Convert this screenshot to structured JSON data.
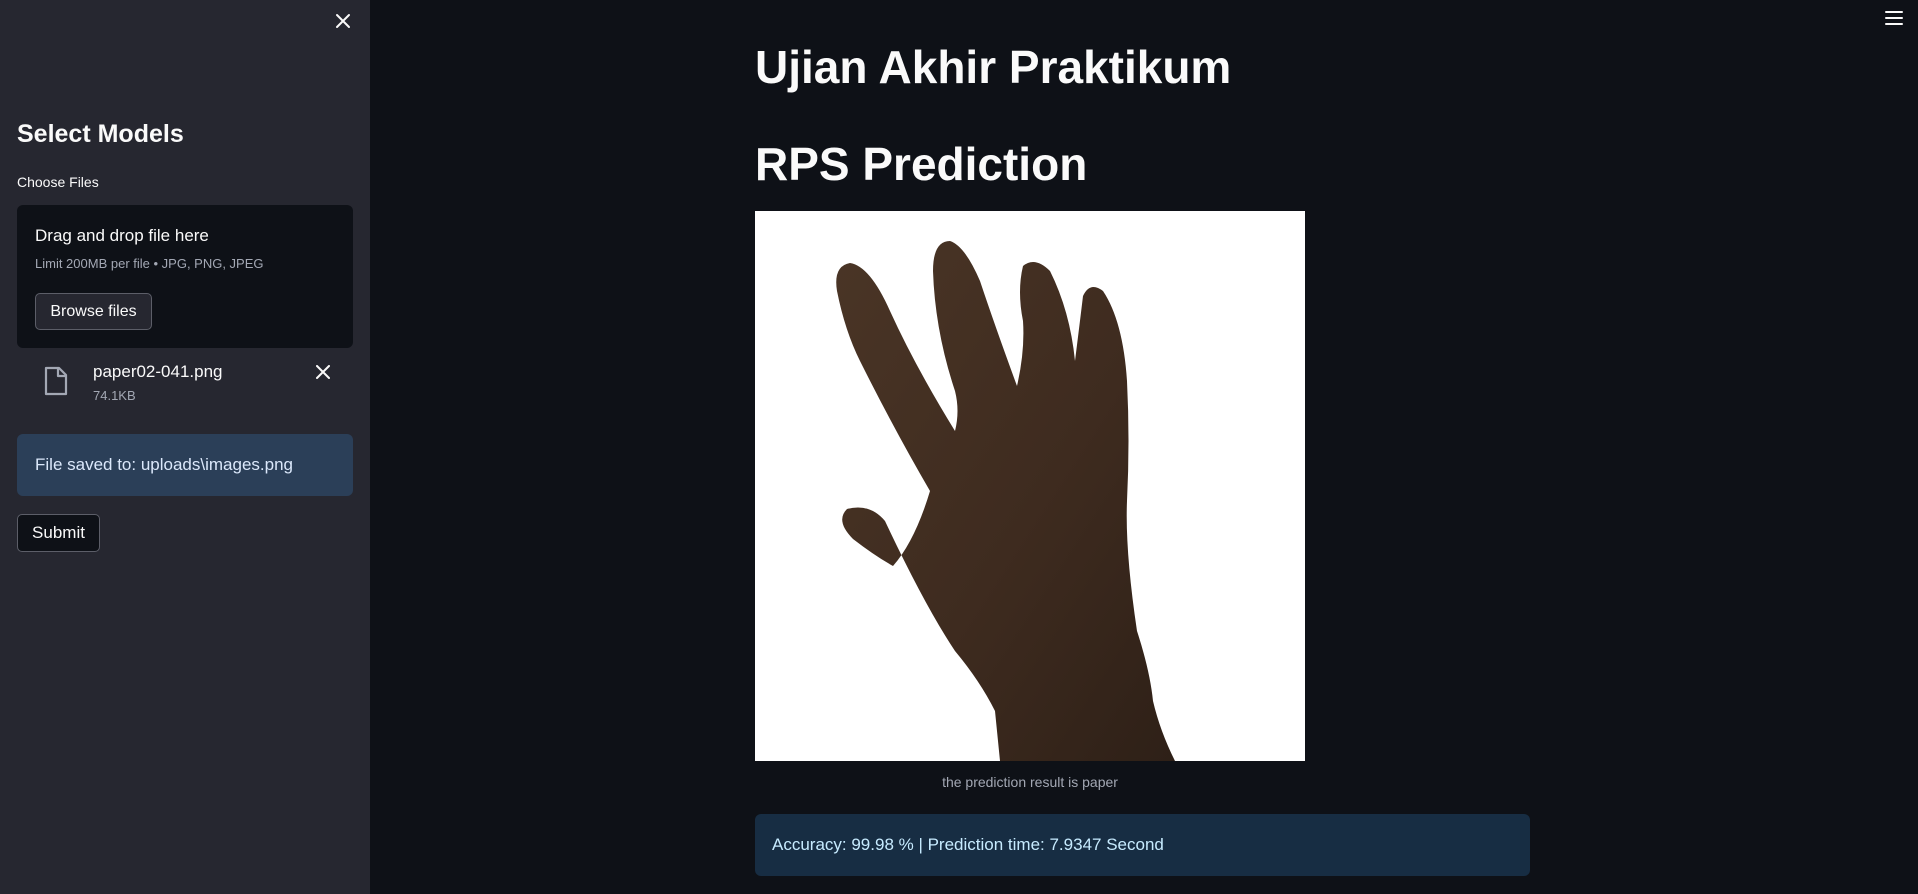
{
  "sidebar": {
    "close_icon": "close-icon",
    "title": "Select Models",
    "uploader": {
      "label": "Choose Files",
      "drop_text": "Drag and drop file here",
      "limit_text": "Limit 200MB per file • JPG, PNG, JPEG",
      "browse_label": "Browse files"
    },
    "uploaded_file": {
      "icon": "file-icon",
      "name": "paper02-041.png",
      "size": "74.1KB",
      "remove_icon": "close-icon"
    },
    "saved_message": "File saved to: uploads\\images.png",
    "submit_label": "Submit"
  },
  "header": {
    "menu_icon": "hamburger-menu-icon"
  },
  "main": {
    "title": "Ujian Akhir Praktikum",
    "subtitle": "RPS Prediction",
    "image": {
      "content": "hand-paper-gesture",
      "background": "#ffffff"
    },
    "caption": "the prediction result is paper",
    "result_message": "Accuracy: 99.98 % | Prediction time: 7.9347 Second"
  },
  "colors": {
    "main_bg": "#0e1117",
    "sidebar_bg": "#262730",
    "info_bg": "#172d43",
    "info_text": "#c7ebff"
  }
}
